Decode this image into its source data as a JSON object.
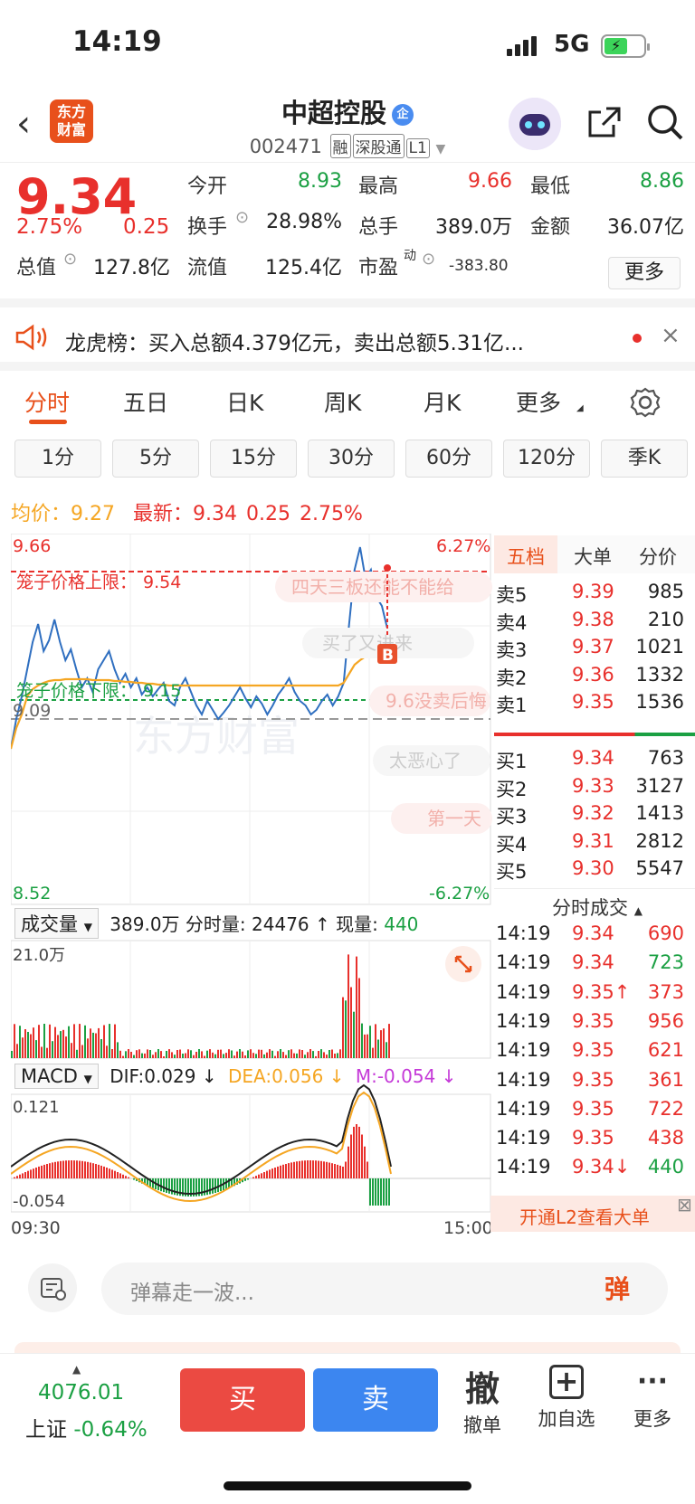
{
  "status": {
    "time": "14:19",
    "network": "5G"
  },
  "header": {
    "name": "中超控股",
    "name_badge": "企",
    "code": "002471",
    "tags": [
      "融",
      "深股通",
      "L1"
    ]
  },
  "quote": {
    "price": "9.34",
    "pct": "2.75%",
    "chg": "0.25",
    "open_label": "今开",
    "open": "8.93",
    "high_label": "最高",
    "high": "9.66",
    "low_label": "最低",
    "low": "8.86",
    "turnover_label": "换手",
    "turnover": "28.98%",
    "vol_label": "总手",
    "vol": "389.0万",
    "amount_label": "金额",
    "amount": "36.07亿",
    "mcap_label": "总值",
    "mcap": "127.8亿",
    "float_label": "流值",
    "float": "125.4亿",
    "pe_label": "市盈",
    "pe_sup": "动",
    "pe": "-383.80",
    "more": "更多"
  },
  "news": {
    "text": "龙虎榜：买入总额4.379亿元，卖出总额5.31亿..."
  },
  "tabs": [
    "分时",
    "五日",
    "日K",
    "周K",
    "月K",
    "更多"
  ],
  "periods": [
    "1分",
    "5分",
    "15分",
    "30分",
    "60分",
    "120分",
    "季K"
  ],
  "avg": {
    "avg_label": "均价：",
    "avg": "9.27",
    "latest_label": "最新：",
    "latest": "9.34",
    "chg": "0.25",
    "pct": "2.75%"
  },
  "chart": {
    "ymax": "9.66",
    "ymin": "8.52",
    "pmax": "6.27%",
    "pmin": "-6.27%",
    "prevclose": "9.09",
    "upper_label": "笼子价格上限：",
    "upper": "9.54",
    "lower_label": "笼子价格下限：",
    "lower": "9.15",
    "time_start": "09:30",
    "time_end": "15:00",
    "buy_marker": "B",
    "danmaku": [
      "四天三板还能不能给",
      "买了又进来",
      "9.6没卖后悔",
      "太恶心了",
      "第一天"
    ],
    "watermark": "东方财富"
  },
  "volume": {
    "label": "成交量",
    "total": "389.0万",
    "min_label": "分时量:",
    "min": "24476",
    "cur_label": "现量:",
    "cur": "440",
    "ymax": "21.0万"
  },
  "macd": {
    "label": "MACD",
    "dif": "DIF:0.029",
    "dea": "DEA:0.056",
    "m": "M:-0.054",
    "ymax": "0.121",
    "ymin": "-0.054"
  },
  "book_tabs": [
    "五档",
    "大单",
    "分价"
  ],
  "asks": [
    {
      "l": "卖5",
      "p": "9.39",
      "v": "985"
    },
    {
      "l": "卖4",
      "p": "9.38",
      "v": "210"
    },
    {
      "l": "卖3",
      "p": "9.37",
      "v": "1021"
    },
    {
      "l": "卖2",
      "p": "9.36",
      "v": "1332"
    },
    {
      "l": "卖1",
      "p": "9.35",
      "v": "1536"
    }
  ],
  "bids": [
    {
      "l": "买1",
      "p": "9.34",
      "v": "763"
    },
    {
      "l": "买2",
      "p": "9.33",
      "v": "3127"
    },
    {
      "l": "买3",
      "p": "9.32",
      "v": "1413"
    },
    {
      "l": "买4",
      "p": "9.31",
      "v": "2812"
    },
    {
      "l": "买5",
      "p": "9.30",
      "v": "5547"
    }
  ],
  "ticks_title": "分时成交",
  "ticks": [
    {
      "t": "14:19",
      "p": "9.34",
      "v": "690",
      "c": "red"
    },
    {
      "t": "14:19",
      "p": "9.34",
      "v": "723",
      "c": "grn"
    },
    {
      "t": "14:19",
      "p": "9.35↑",
      "v": "373",
      "c": "red"
    },
    {
      "t": "14:19",
      "p": "9.35",
      "v": "956",
      "c": "red"
    },
    {
      "t": "14:19",
      "p": "9.35",
      "v": "621",
      "c": "red"
    },
    {
      "t": "14:19",
      "p": "9.35",
      "v": "361",
      "c": "red"
    },
    {
      "t": "14:19",
      "p": "9.35",
      "v": "722",
      "c": "red"
    },
    {
      "t": "14:19",
      "p": "9.35",
      "v": "438",
      "c": "red"
    },
    {
      "t": "14:19",
      "p": "9.34↓",
      "v": "440",
      "c": "grn"
    }
  ],
  "l2_promo": "开通L2查看大单",
  "danmu_input": {
    "placeholder": "弹幕走一波...",
    "btn": "弹"
  },
  "index": {
    "value": "4076.01",
    "name": "上证",
    "pct": "-0.64%"
  },
  "actions": {
    "buy": "买",
    "sell": "卖",
    "cancel_icon": "撤",
    "cancel": "撤单",
    "add": "加自选",
    "more": "更多"
  },
  "colors": {
    "up": "#e8302c",
    "down": "#1ba043",
    "accent": "#e8501b",
    "avg_line": "#f5a623",
    "price_line": "#2f6fc0"
  }
}
